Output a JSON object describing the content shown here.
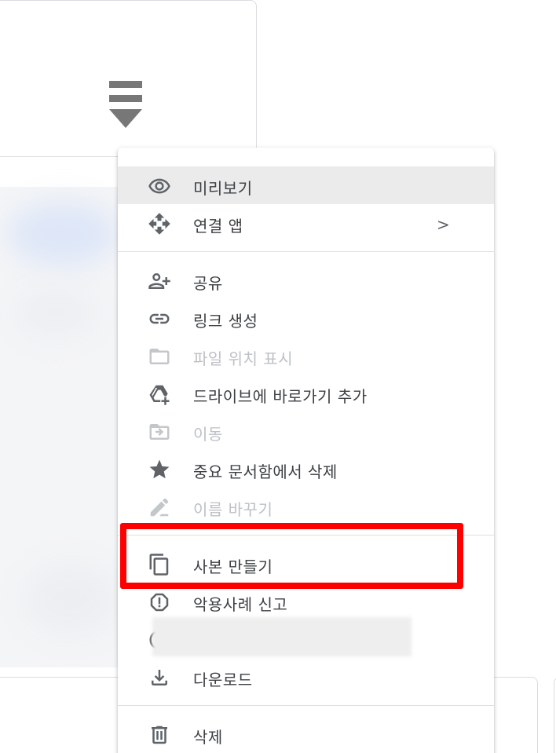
{
  "menu": {
    "items": [
      {
        "label": "미리보기",
        "icon": "eye-icon",
        "state": "hover"
      },
      {
        "label": "연결 앱",
        "icon": "move-arrows-icon",
        "submenu": ">"
      },
      {
        "label": "공유",
        "icon": "person-add-icon"
      },
      {
        "label": "링크 생성",
        "icon": "link-icon"
      },
      {
        "label": "파일 위치 표시",
        "icon": "folder-icon",
        "disabled": true
      },
      {
        "label": "드라이브에 바로가기 추가",
        "icon": "drive-add-icon"
      },
      {
        "label": "이동",
        "icon": "folder-move-icon",
        "disabled": true
      },
      {
        "label": "중요 문서함에서 삭제",
        "icon": "star-icon"
      },
      {
        "label": "이름 바꾸기",
        "icon": "pencil-icon",
        "disabled": true
      },
      {
        "label": "사본 만들기",
        "icon": "copy-icon",
        "highlighted": true
      },
      {
        "label": "악용사례 신고",
        "icon": "report-icon"
      },
      {
        "label": "",
        "icon": "info-icon",
        "redacted": true
      },
      {
        "label": "다운로드",
        "icon": "download-icon"
      },
      {
        "label": "삭제",
        "icon": "trash-icon"
      }
    ]
  },
  "colors": {
    "highlight": "#ff0000",
    "hover": "#ebebeb",
    "text": "#3c4043",
    "disabled_text": "#bdc1c6"
  }
}
